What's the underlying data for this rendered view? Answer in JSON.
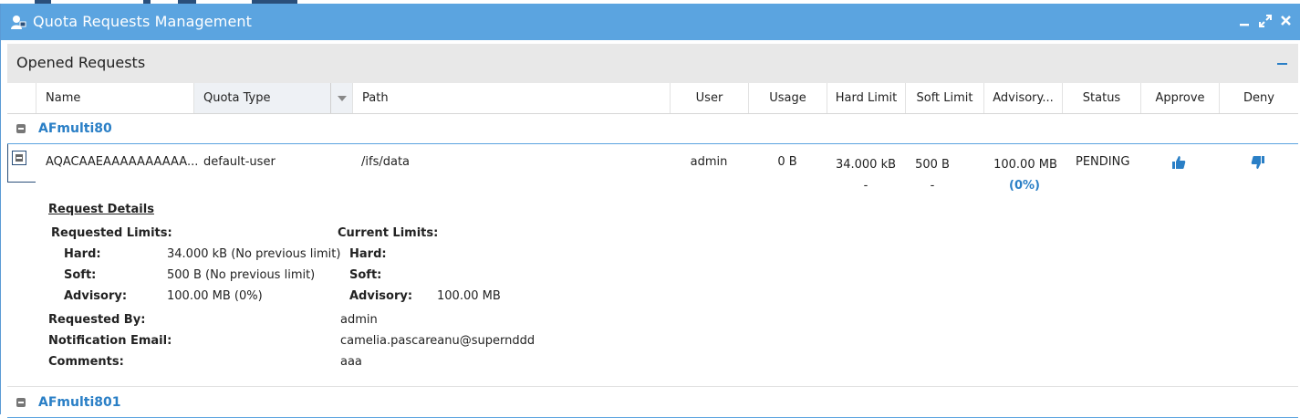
{
  "window": {
    "title": "Quota Requests Management"
  },
  "panel": {
    "title": "Opened Requests"
  },
  "columns": {
    "name": "Name",
    "quota_type": "Quota Type",
    "path": "Path",
    "user": "User",
    "usage": "Usage",
    "hard_limit": "Hard Limit",
    "soft_limit": "Soft Limit",
    "advisory": "Advisory...",
    "status": "Status",
    "approve": "Approve",
    "deny": "Deny"
  },
  "groups": [
    {
      "name": "AFmulti80"
    },
    {
      "name": "AFmulti801"
    }
  ],
  "request": {
    "name": "AQACAAEAAAAAAAAAA...",
    "quota_type": "default-user",
    "path": "/ifs/data",
    "user": "admin",
    "usage": "0 B",
    "hard_limit": "34.000 kB",
    "hard_prev": "-",
    "soft_limit": "500 B",
    "soft_prev": "-",
    "advisory": "100.00 MB",
    "advisory_pct": "(0%)",
    "status": "PENDING"
  },
  "details": {
    "title": "Request Details",
    "requested_limits_label": "Requested Limits:",
    "current_limits_label": "Current Limits:",
    "hard_label": "Hard:",
    "soft_label": "Soft:",
    "advisory_label": "Advisory:",
    "req_hard": "34.000 kB  (No previous limit)",
    "req_soft": "500 B  (No previous limit)",
    "req_advisory": "100.00 MB  (0%)",
    "cur_hard": "",
    "cur_soft": "",
    "cur_advisory": "100.00 MB",
    "requested_by_label": "Requested By:",
    "requested_by": "admin",
    "email_label": "Notification Email:",
    "email": "camelia.pascareanu@supernddd",
    "comments_label": "Comments:",
    "comments": "aaa"
  },
  "colors": {
    "titlebar": "#5ba4e0",
    "accent": "#2a7fc6",
    "header_bg": "#e8e8e8"
  },
  "icons": {
    "window": "user-quota-icon",
    "approve": "thumbs-up-icon",
    "deny": "thumbs-down-icon"
  }
}
